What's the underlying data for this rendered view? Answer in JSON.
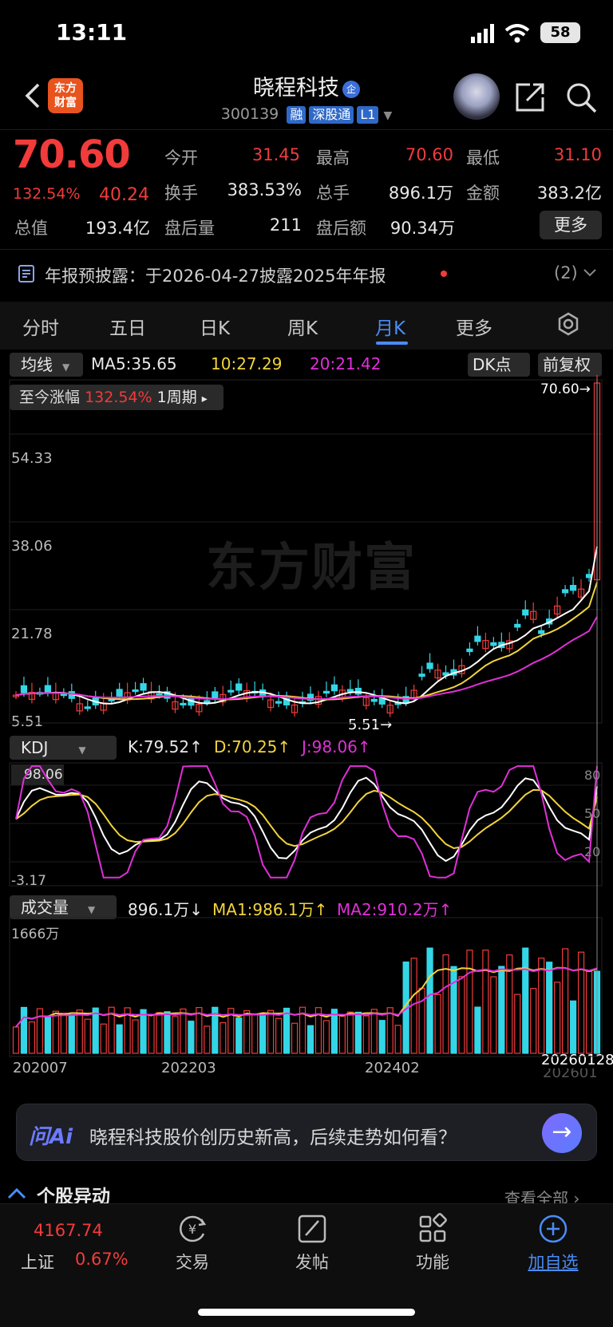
{
  "status_bar": {
    "time": "13:11",
    "battery": "58"
  },
  "header": {
    "logo_line1": "东方",
    "logo_line2": "财富",
    "stock_name": "晓程科技",
    "name_badge": "企",
    "code": "300139",
    "tags": [
      "融",
      "深股通",
      "L1"
    ]
  },
  "quote": {
    "price": "70.60",
    "change_pct": "132.54%",
    "change": "40.24",
    "open_label": "今开",
    "open": "31.45",
    "high_label": "最高",
    "high": "70.60",
    "low_label": "最低",
    "low": "31.10",
    "turnover_label": "换手",
    "turnover": "383.53%",
    "volume_label": "总手",
    "volume": "896.1万",
    "amount_label": "金额",
    "amount": "383.2亿",
    "mcap_label": "总值",
    "mcap": "193.4亿",
    "ah_vol_label": "盘后量",
    "ah_vol": "211",
    "ah_amt_label": "盘后额",
    "ah_amt": "90.34万",
    "more": "更多"
  },
  "notice": {
    "text": "年报预披露：于2026-04-27披露2025年年报",
    "count": "(2)"
  },
  "tabs": [
    "分时",
    "五日",
    "日K",
    "周K",
    "月K",
    "更多"
  ],
  "chart": {
    "ma_selector": "均线",
    "ma5": "MA5:35.65",
    "ma10": "10:27.29",
    "ma20": "20:21.42",
    "dk_button": "DK点",
    "adjust_button": "前复权",
    "since_label": "至今涨幅",
    "since_value": "132.54%",
    "period": "1周期",
    "watermark": "东方财富",
    "y_labels": [
      "54.33",
      "38.06",
      "21.78",
      "5.51"
    ],
    "max_marker": "70.60",
    "min_marker": "5.51",
    "kdj_selector": "KDJ",
    "k": "K:79.52",
    "d": "D:70.25",
    "j": "J:98.06",
    "kdj_top": "98.06",
    "kdj_bottom": "-3.17",
    "kdj_levels": [
      "80",
      "50",
      "20"
    ],
    "vol_selector": "成交量",
    "vol_value": "896.1万",
    "vol_ma1": "MA1:986.1万",
    "vol_ma2": "MA2:910.2万",
    "vol_max": "1666万",
    "x_labels": [
      "202007",
      "202203",
      "202402",
      "20260128"
    ],
    "x_label_behind": "202601",
    "colors": {
      "up": "#f23b3b",
      "down": "#33d6e6",
      "ma5": "#ffffff",
      "ma10": "#f2d33c",
      "ma20": "#e030d8"
    }
  },
  "chart_data": {
    "type": "candlestick",
    "period": "monthly",
    "y_range": [
      5.51,
      70.6
    ],
    "last_close": 70.6,
    "ma": {
      "MA5": 35.65,
      "MA10": 27.29,
      "MA20": 21.42
    },
    "kdj": {
      "K": 79.52,
      "D": 70.25,
      "J": 98.06,
      "range": [
        -3.17,
        98.06
      ]
    },
    "volume": {
      "last": "896.1万",
      "MA1": "986.1万",
      "MA2": "910.2万",
      "max": "1666万"
    }
  },
  "ai": {
    "logo": "问Ai",
    "prompt": "晓程科技股价创历史新高，后续走势如何看？"
  },
  "movers": {
    "title": "个股异动",
    "view_all": "查看全部"
  },
  "bottom_nav": {
    "index_value": "4167.74",
    "index_name": "上证",
    "index_pct": "0.67%",
    "items": [
      "交易",
      "发帖",
      "功能",
      "加自选"
    ]
  }
}
